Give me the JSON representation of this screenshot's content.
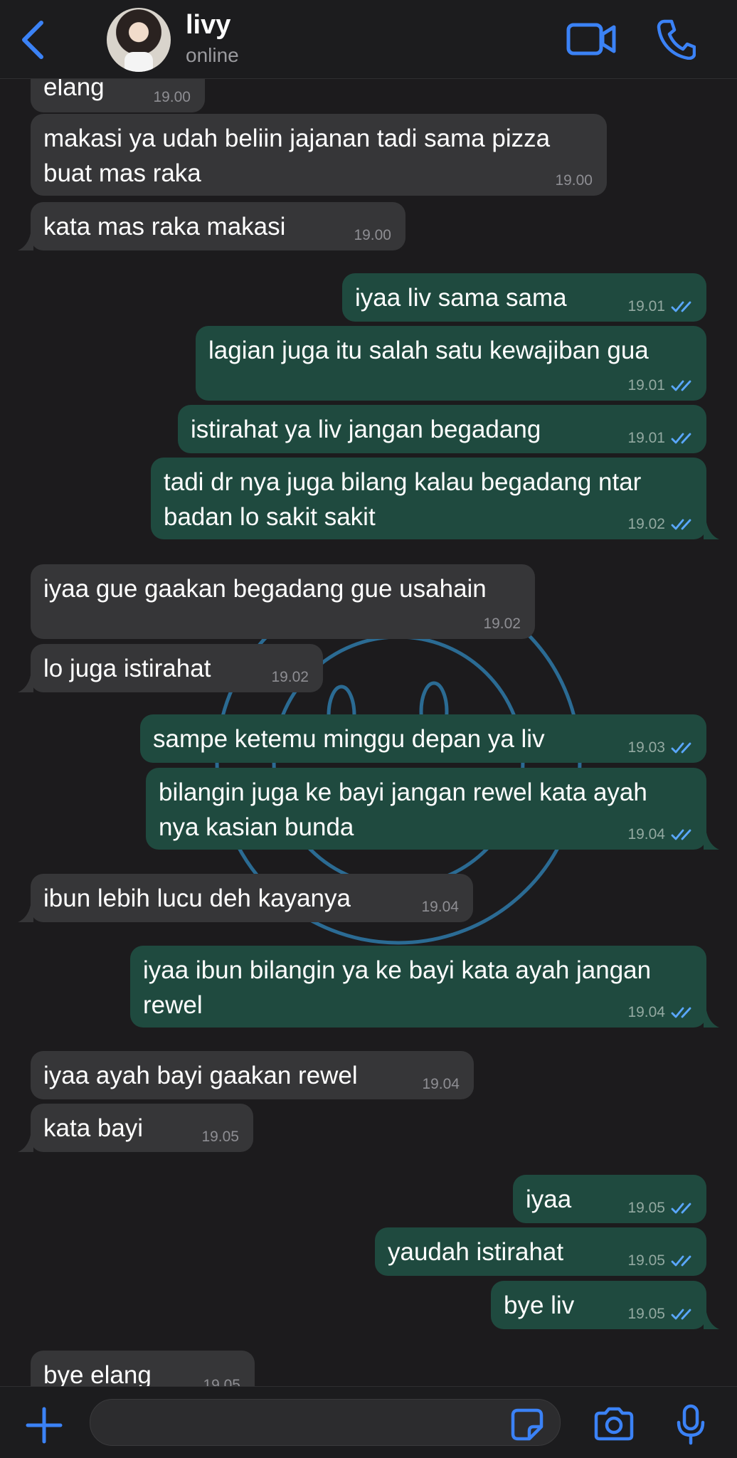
{
  "contact": {
    "name": "livy",
    "status": "online"
  },
  "messages": [
    {
      "dir": "in",
      "text": "elang",
      "time": "19.00"
    },
    {
      "dir": "in",
      "text": "makasi ya udah beliin jajanan tadi sama pizza\nbuat mas raka",
      "time": "19.00"
    },
    {
      "dir": "in",
      "text": "kata mas raka makasi",
      "time": "19.00"
    },
    {
      "dir": "out",
      "text": "iyaa liv sama sama",
      "time": "19.01"
    },
    {
      "dir": "out",
      "text": "lagian juga itu salah satu kewajiban gua",
      "time": "19.01"
    },
    {
      "dir": "out",
      "text": "istirahat ya liv jangan begadang",
      "time": "19.01"
    },
    {
      "dir": "out",
      "text": "tadi dr nya juga bilang kalau begadang ntar\nbadan lo sakit sakit",
      "time": "19.02"
    },
    {
      "dir": "in",
      "text": "iyaa gue gaakan begadang gue usahain",
      "time": "19.02"
    },
    {
      "dir": "in",
      "text": "lo juga istirahat",
      "time": "19.02"
    },
    {
      "dir": "out",
      "text": "sampe ketemu minggu depan ya liv",
      "time": "19.03"
    },
    {
      "dir": "out",
      "text": "bilangin juga ke bayi jangan rewel kata ayah\nnya kasian bunda",
      "time": "19.04"
    },
    {
      "dir": "in",
      "text": "ibun lebih lucu deh kayanya",
      "time": "19.04"
    },
    {
      "dir": "out",
      "text": "iyaa ibun bilangin ya ke bayi kata ayah jangan\nrewel",
      "time": "19.04"
    },
    {
      "dir": "in",
      "text": "iyaa ayah bayi gaakan rewel",
      "time": "19.04"
    },
    {
      "dir": "in",
      "text": "kata bayi",
      "time": "19.05"
    },
    {
      "dir": "out",
      "text": "iyaa",
      "time": "19.05"
    },
    {
      "dir": "out",
      "text": "yaudah istirahat",
      "time": "19.05"
    },
    {
      "dir": "out",
      "text": "bye liv",
      "time": "19.05"
    },
    {
      "dir": "in",
      "text": "bye elang",
      "time": "19.05"
    }
  ],
  "colors": {
    "accent": "#3b82f6",
    "incoming_bubble": "#363638",
    "outgoing_bubble": "#1f4a3f",
    "read_check": "#5aa7ff"
  },
  "icons": {
    "back": "chevron-left-icon",
    "video": "video-camera-icon",
    "call": "phone-icon",
    "attach": "plus-icon",
    "sticker": "sticker-icon",
    "camera": "camera-icon",
    "mic": "microphone-icon"
  }
}
